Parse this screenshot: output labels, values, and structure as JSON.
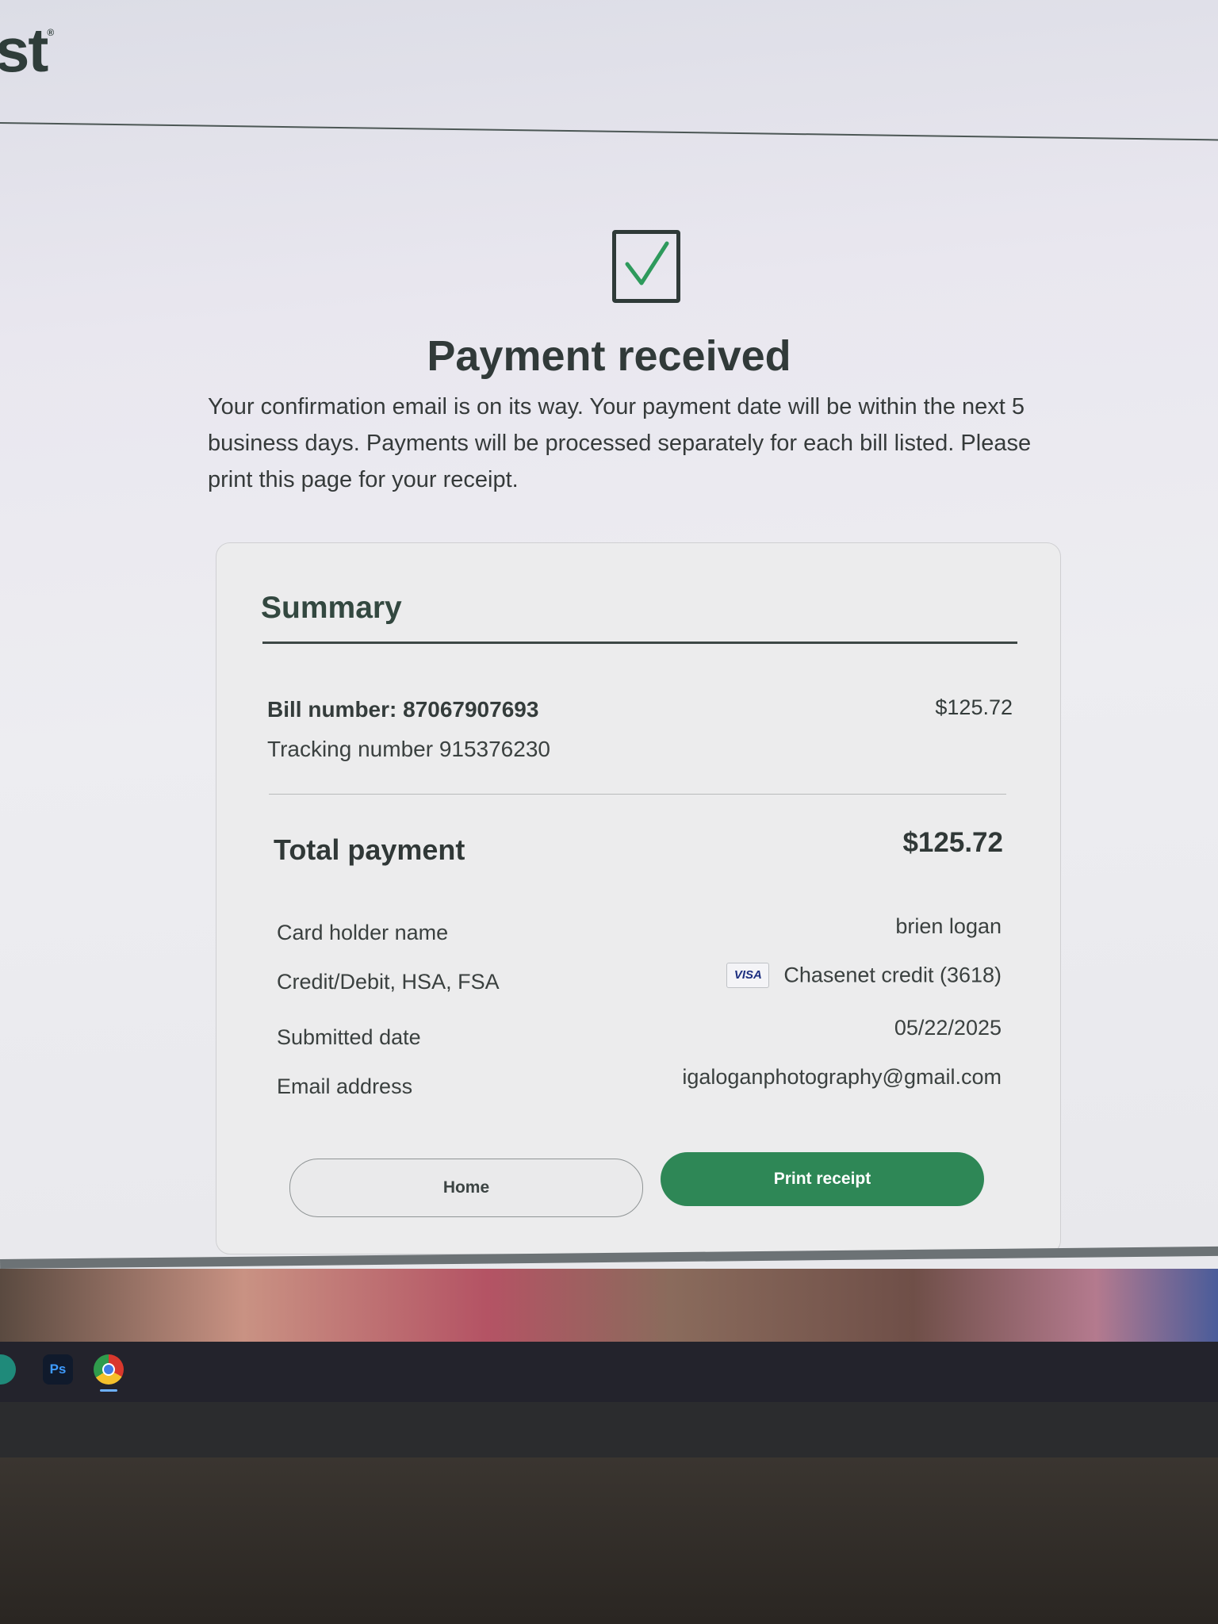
{
  "brand": {
    "text": "st"
  },
  "confirmation": {
    "icon": "check-square-icon",
    "title": "Payment received",
    "message": "Your confirmation email is on its way. Your payment date will be within the next 5 business days. Payments will be processed separately for each bill listed. Please print this page for your receipt."
  },
  "summary": {
    "title": "Summary",
    "bill_number": "Bill number: 87067907693",
    "bill_amount": "$125.72",
    "tracking": "Tracking number  915376230",
    "total_label": "Total payment",
    "total_value": "$125.72",
    "rows": {
      "card_holder_label": "Card holder name",
      "card_holder_value": "brien logan",
      "payment_method_label": "Credit/Debit, HSA, FSA",
      "payment_method_badge": "VISA",
      "payment_method_value": "Chasenet credit (3618)",
      "submitted_label": "Submitted date",
      "submitted_value": "05/22/2025",
      "email_label": "Email address",
      "email_value": "igaloganphotography@gmail.com"
    },
    "buttons": {
      "home": "Home",
      "print": "Print receipt"
    }
  },
  "taskbar": {
    "ps_label": "Ps"
  },
  "colors": {
    "primary_button": "#2e8756",
    "check": "#2e9a5c",
    "text": "#313a39"
  }
}
